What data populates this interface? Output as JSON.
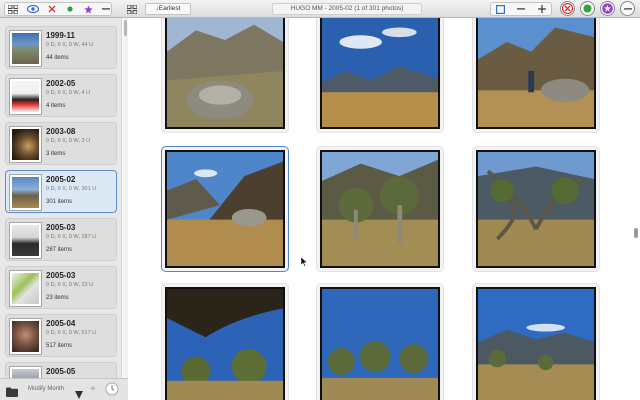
{
  "window": {
    "title": "HUGO MM - 2005-02 (1 of 301 photos)"
  },
  "toolbar": {
    "sort_label": "↓Earliest",
    "icons": [
      "grid-icon",
      "eye-icon",
      "x-icon",
      "dot-icon",
      "star-icon",
      "minus-icon",
      "grid-icon",
      "square-icon",
      "minus-icon",
      "plus-icon",
      "close-icon",
      "circle-icon",
      "star-icon",
      "minus-icon"
    ],
    "colors": {
      "accent": "#2f6fd6",
      "red": "#d93232",
      "green": "#35a03b",
      "purple": "#9a3bd0"
    }
  },
  "sidebar": {
    "albums": [
      {
        "name": "1999-11",
        "stats": "0 D, 0 X, 0 W, 44 U",
        "count": "44 items",
        "selected": false
      },
      {
        "name": "2002-05",
        "stats": "0 D, 0 X, 0 W, 4 U",
        "count": "4 items",
        "selected": false
      },
      {
        "name": "2003-08",
        "stats": "0 D, 0 X, 0 W, 3 U",
        "count": "3 items",
        "selected": false
      },
      {
        "name": "2005-02",
        "stats": "0 D, 0 X, 0 W, 301 U",
        "count": "301 items",
        "selected": true
      },
      {
        "name": "2005-03",
        "stats": "0 D, 0 X, 0 W, 287 U",
        "count": "287 items",
        "selected": false
      },
      {
        "name": "2005-03",
        "stats": "0 D, 0 X, 0 W, 23 U",
        "count": "23 items",
        "selected": false
      },
      {
        "name": "2005-04",
        "stats": "0 D, 0 X, 0 W, 517 U",
        "count": "517 items",
        "selected": false
      },
      {
        "name": "2005-05",
        "stats": "",
        "count": "",
        "selected": false
      }
    ]
  },
  "bottombar": {
    "label": "Modify Month"
  },
  "grid": {
    "selected_index": 3,
    "photo_count": 9
  }
}
